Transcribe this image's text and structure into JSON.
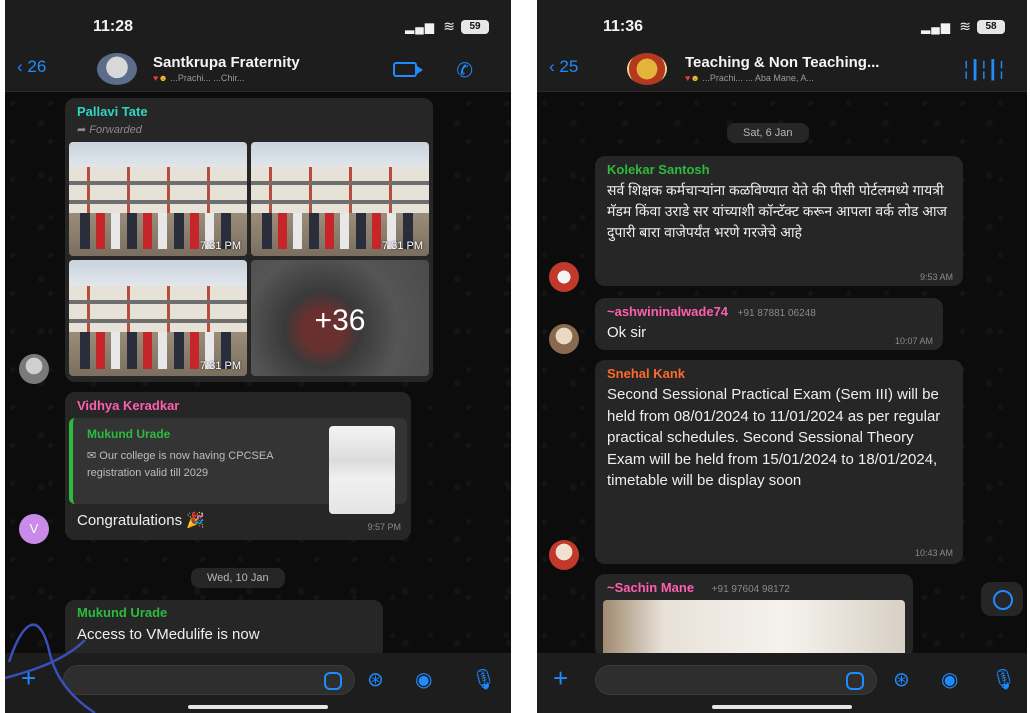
{
  "left": {
    "status": {
      "time": "11:28",
      "battery": "59"
    },
    "header": {
      "back_count": "26",
      "title": "Santkrupa Fraternity",
      "subtitle": "...Prachi...  ...Chir..."
    },
    "album": {
      "sender": "Pallavi Tate",
      "forwarded": "Forwarded",
      "times": [
        "7:31 PM",
        "7:31 PM",
        "7:31 PM"
      ],
      "more_count": "+36"
    },
    "reply_msg": {
      "sender": "Vidhya Keradkar",
      "quote_sender": "Mukund Urade",
      "quote_text": "Our college is now having CPCSEA registration valid till 2029",
      "text": "Congratulations 🎉",
      "time": "9:57 PM",
      "avatar_initial": "V"
    },
    "date_chip": "Wed, 10 Jan",
    "last_msg": {
      "sender": "Mukund Urade",
      "text": "Access to VMedulife is now"
    }
  },
  "right": {
    "status": {
      "time": "11:36",
      "battery": "58"
    },
    "header": {
      "back_count": "25",
      "title": "Teaching & Non Teaching...",
      "subtitle": "...Prachi...  ... Aba Mane, A..."
    },
    "date_chip": "Sat, 6 Jan",
    "msg1": {
      "sender": "Kolekar Santosh",
      "text": "सर्व शिक्षक कर्मचाऱ्यांना कळविण्यात येते की पीसी पोर्टलमध्ये गायत्री मॅडम किंवा उराडे सर यांच्याशी कॉन्टॅक्ट करून आपला वर्क लोड आज दुपारी बारा वाजेपर्यंत भरणे गरजेचे आहे",
      "time": "9:53 AM"
    },
    "msg2": {
      "sender": "~ashwininalwade74",
      "phone": "+91 87881 06248",
      "text": "Ok sir",
      "time": "10:07 AM"
    },
    "msg3": {
      "sender": "Snehal Kank",
      "text": "Second Sessional Practical Exam (Sem III) will be held from 08/01/2024 to 11/01/2024 as per regular practical schedules. Second Sessional Theory Exam will be held from 15/01/2024 to 18/01/2024, timetable will be display soon",
      "time": "10:43 AM"
    },
    "msg4": {
      "sender": "~Sachin Mane",
      "phone": "+91 97604 98172"
    }
  },
  "colors": {
    "accent": "#1f8bff",
    "bubble": "#262626",
    "green_name": "#2dbb3e",
    "pink_name": "#ff5fb0",
    "orange_name": "#ff6a2a"
  }
}
